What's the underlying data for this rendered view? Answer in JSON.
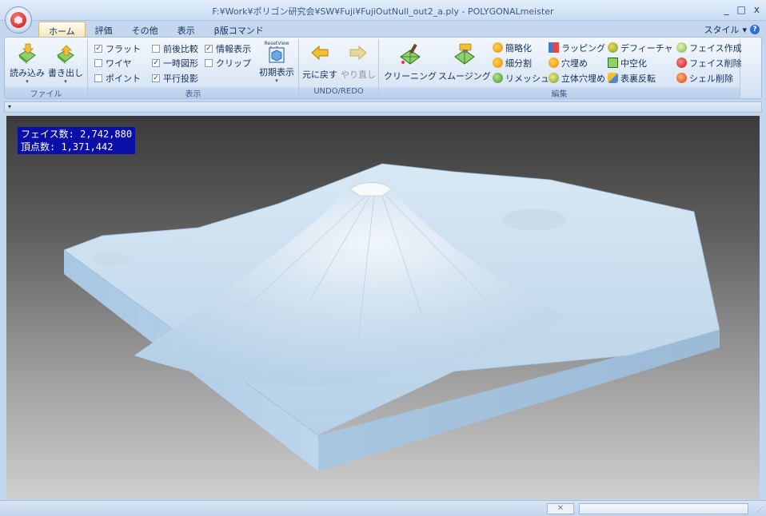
{
  "window": {
    "title": "F:¥Work¥ポリゴン研究会¥SW¥Fuji¥FujiOutNull_out2_a.ply - POLYGONALmeister",
    "controls": {
      "minimize": "_",
      "maximize": "□",
      "close": "x"
    }
  },
  "tabs": [
    {
      "label": "ホーム",
      "active": true
    },
    {
      "label": "評価"
    },
    {
      "label": "その他"
    },
    {
      "label": "表示"
    },
    {
      "label": "β版コマンド"
    }
  ],
  "style_menu": {
    "label": "スタイル",
    "arrow": "▾",
    "help": "?"
  },
  "ribbon": {
    "file": {
      "label": "ファイル",
      "import": "読み込み",
      "export": "書き出し",
      "dropdown": "▾"
    },
    "display": {
      "label": "表示",
      "checks": [
        {
          "label": "フラット",
          "checked": true
        },
        {
          "label": "ワイヤ",
          "checked": false
        },
        {
          "label": "ポイント",
          "checked": false
        },
        {
          "label": "前後比較",
          "checked": false
        },
        {
          "label": "一時図形",
          "checked": true
        },
        {
          "label": "平行投影",
          "checked": true
        },
        {
          "label": "情報表示",
          "checked": true
        },
        {
          "label": "クリップ",
          "checked": false
        }
      ],
      "check_mark": "✓",
      "reset_caption": "ResetView",
      "reset_label": "初期表示",
      "dropdown": "▾"
    },
    "undo": {
      "label": "UNDO/REDO",
      "undo": "元に戻す",
      "redo": "やり直し"
    },
    "edit": {
      "label": "編集",
      "cleaning": "クリーニング",
      "smoothing": "スムージング",
      "simplify": "簡略化",
      "subdivide": "細分割",
      "remesh": "リメッシュ",
      "wrapping": "ラッピング",
      "fill_hole": "穴埋め",
      "solid_fill": "立体穴埋め",
      "defeature": "デフィーチャ",
      "hollow": "中空化",
      "flip": "表裏反転",
      "face_create": "フェイス作成",
      "face_delete": "フェイス削除",
      "shell_delete": "シェル削除"
    }
  },
  "qat": {
    "arrow": "▾"
  },
  "viewport": {
    "info_lines": [
      "フェイス数: 2,742,880",
      "頂点数: 1,371,442"
    ],
    "model_color": "#b8d4ea"
  },
  "status": {
    "cancel_symbol": "✕",
    "grip": "⋰"
  }
}
